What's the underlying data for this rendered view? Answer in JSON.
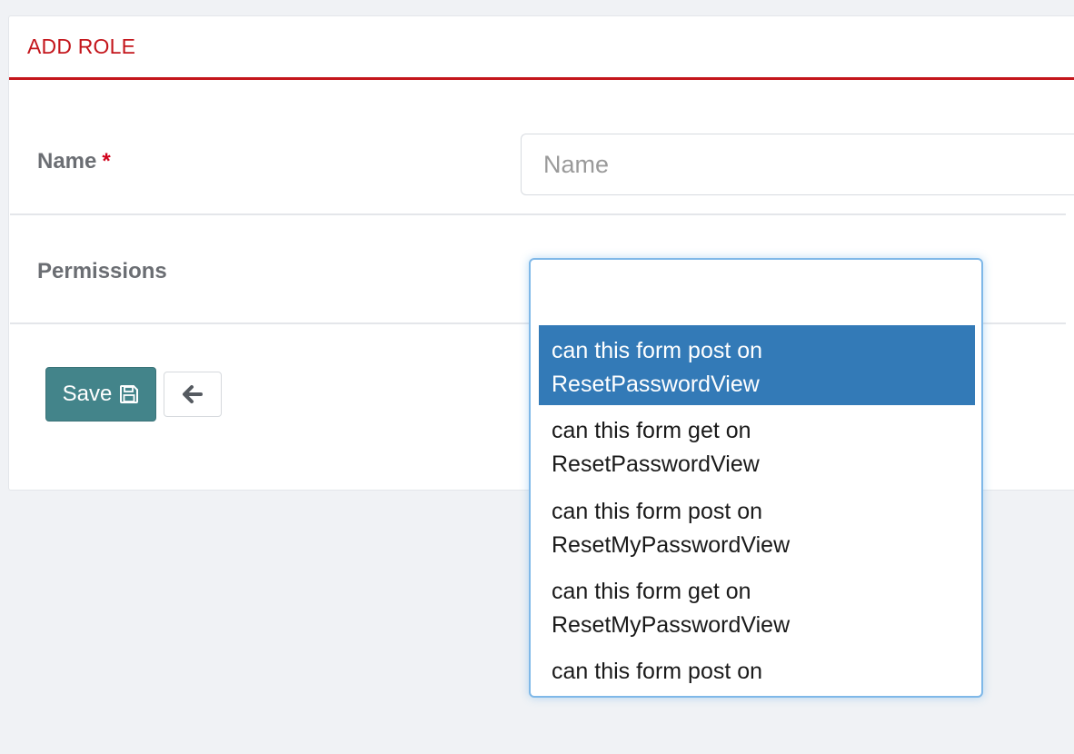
{
  "panel": {
    "title": "ADD ROLE"
  },
  "form": {
    "name": {
      "label": "Name",
      "required_marker": "*",
      "placeholder": "Name",
      "value": ""
    },
    "permissions": {
      "label": "Permissions",
      "search_value": "",
      "options": [
        {
          "line1": "can this form post on",
          "line2": "ResetPasswordView",
          "highlighted": true
        },
        {
          "line1": "can this form get on",
          "line2": "ResetPasswordView",
          "highlighted": false
        },
        {
          "line1": "can this form post on",
          "line2": "ResetMyPasswordView",
          "highlighted": false
        },
        {
          "line1": "can this form get on",
          "line2": "ResetMyPasswordView",
          "highlighted": false
        },
        {
          "line1": "can this form post on",
          "line2": "",
          "highlighted": false
        }
      ]
    }
  },
  "actions": {
    "save_label": "Save",
    "save_icon": "floppy-disk-icon",
    "back_icon": "arrow-left-icon"
  },
  "colors": {
    "accent_red": "#c4161c",
    "save_button": "#43848a",
    "highlight": "#337ab7",
    "focus_border": "#7fb8e8"
  }
}
